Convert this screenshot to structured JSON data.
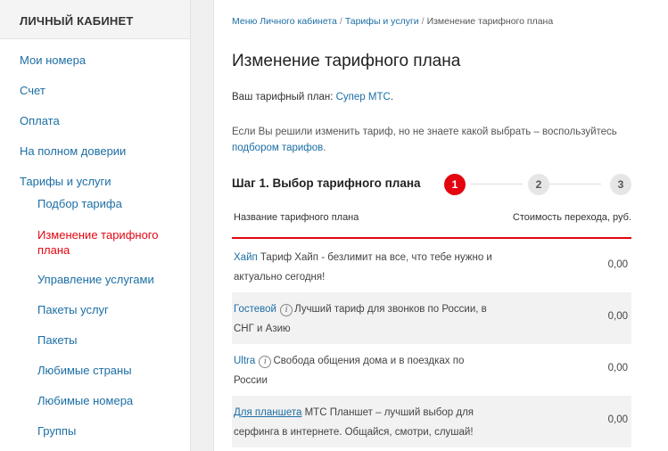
{
  "sidebar": {
    "header": "ЛИЧНЫЙ КАБИНЕТ",
    "items": [
      {
        "label": "Мои номера"
      },
      {
        "label": "Счет"
      },
      {
        "label": "Оплата"
      },
      {
        "label": "На полном доверии"
      },
      {
        "label": "Тарифы и услуги"
      },
      {
        "label": "Подбор тарифа"
      },
      {
        "label": "Изменение тарифного плана"
      },
      {
        "label": "Управление услугами"
      },
      {
        "label": "Пакеты услуг"
      },
      {
        "label": "Пакеты"
      },
      {
        "label": "Любимые страны"
      },
      {
        "label": "Любимые номера"
      },
      {
        "label": "Группы"
      }
    ]
  },
  "breadcrumb": {
    "items": [
      "Меню Личного кабинета",
      "Тарифы и услуги",
      "Изменение тарифного плана"
    ],
    "separator": "/"
  },
  "page": {
    "title": "Изменение тарифного плана",
    "current_plan_prefix": "Ваш тарифный план:",
    "current_plan_name": "Супер МТС",
    "current_plan_suffix": ".",
    "hint_text": "Если Вы решили изменить тариф, но не знаете какой выбрать – воспользуйтесь",
    "hint_link": "подбором тарифов",
    "hint_suffix": "."
  },
  "steps": {
    "title": "Шаг 1. Выбор тарифного плана",
    "items": [
      "1",
      "2",
      "3"
    ],
    "active_color": "#e30611",
    "inactive_color": "#e6e6e6"
  },
  "table": {
    "col_name": "Название тарифного плана",
    "col_cost": "Стоимость перехода, руб.",
    "rows": [
      {
        "name": "Хайп",
        "has_info_icon": false,
        "description": "Тариф Хайп - безлимит на все, что тебе нужно и актуально сегодня!",
        "cost": "0,00"
      },
      {
        "name": "Гостевой",
        "has_info_icon": true,
        "description": "Лучший тариф для звонков по России, в СНГ и Азию",
        "cost": "0,00"
      },
      {
        "name": "Ultra",
        "has_info_icon": true,
        "description": "Свобода общения дома и в поездках по России",
        "cost": "0,00"
      },
      {
        "name": "Для планшета",
        "has_info_icon": false,
        "description": "МТС Планшет – лучший выбор для серфинга в интернете. Общайся, смотри, слушай!",
        "cost": "0,00"
      }
    ]
  },
  "colors": {
    "accent": "#e30611",
    "link": "#1c6ea4"
  }
}
